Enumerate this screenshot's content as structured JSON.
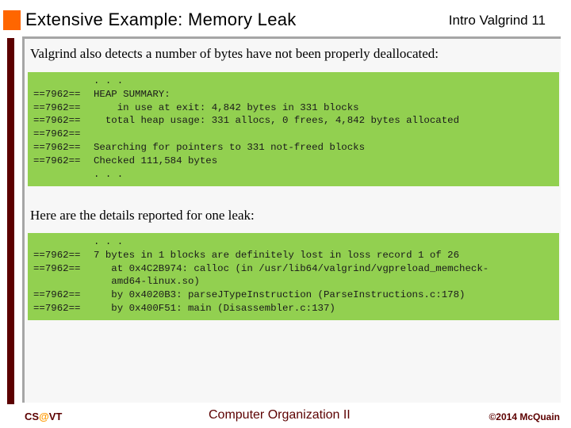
{
  "header": {
    "title": "Extensive Example:  Memory Leak",
    "tag": "Intro Valgrind 11"
  },
  "colors": {
    "accent_square": "#ff6600",
    "left_bar": "#5c0000",
    "code_background": "#92d050",
    "footer_text": "#5c0000",
    "footer_at": "#ff9900"
  },
  "body": {
    "intro_text": "Valgrind also detects a number of bytes have not been properly deallocated:",
    "heap_summary_block": [
      {
        "pid": "",
        "text": ". . ."
      },
      {
        "pid": "==7962==",
        "text": "HEAP SUMMARY:"
      },
      {
        "pid": "==7962==",
        "text": "    in use at exit: 4,842 bytes in 331 blocks"
      },
      {
        "pid": "==7962==",
        "text": "  total heap usage: 331 allocs, 0 frees, 4,842 bytes allocated"
      },
      {
        "pid": "==7962==",
        "text": ""
      },
      {
        "pid": "==7962==",
        "text": "Searching for pointers to 331 not-freed blocks"
      },
      {
        "pid": "==7962==",
        "text": "Checked 111,584 bytes"
      },
      {
        "pid": "",
        "text": ". . ."
      }
    ],
    "details_text": "Here are the details reported for one leak:",
    "leak_block": [
      {
        "pid": "",
        "text": ". . ."
      },
      {
        "pid": "==7962==",
        "text": "7 bytes in 1 blocks are definitely lost in loss record 1 of 26"
      },
      {
        "pid": "==7962==",
        "text": "   at 0x4C2B974: calloc (in /usr/lib64/valgrind/vgpreload_memcheck-"
      },
      {
        "pid": "",
        "text": "   amd64-linux.so)"
      },
      {
        "pid": "==7962==",
        "text": "   by 0x4020B3: parseJTypeInstruction (ParseInstructions.c:178)"
      },
      {
        "pid": "==7962==",
        "text": "   by 0x400F51: main (Disassembler.c:137)"
      }
    ]
  },
  "footer": {
    "left_prefix": "CS",
    "left_at": "@",
    "left_suffix": "VT",
    "center": "Computer Organization II",
    "right": "©2014 McQuain"
  }
}
